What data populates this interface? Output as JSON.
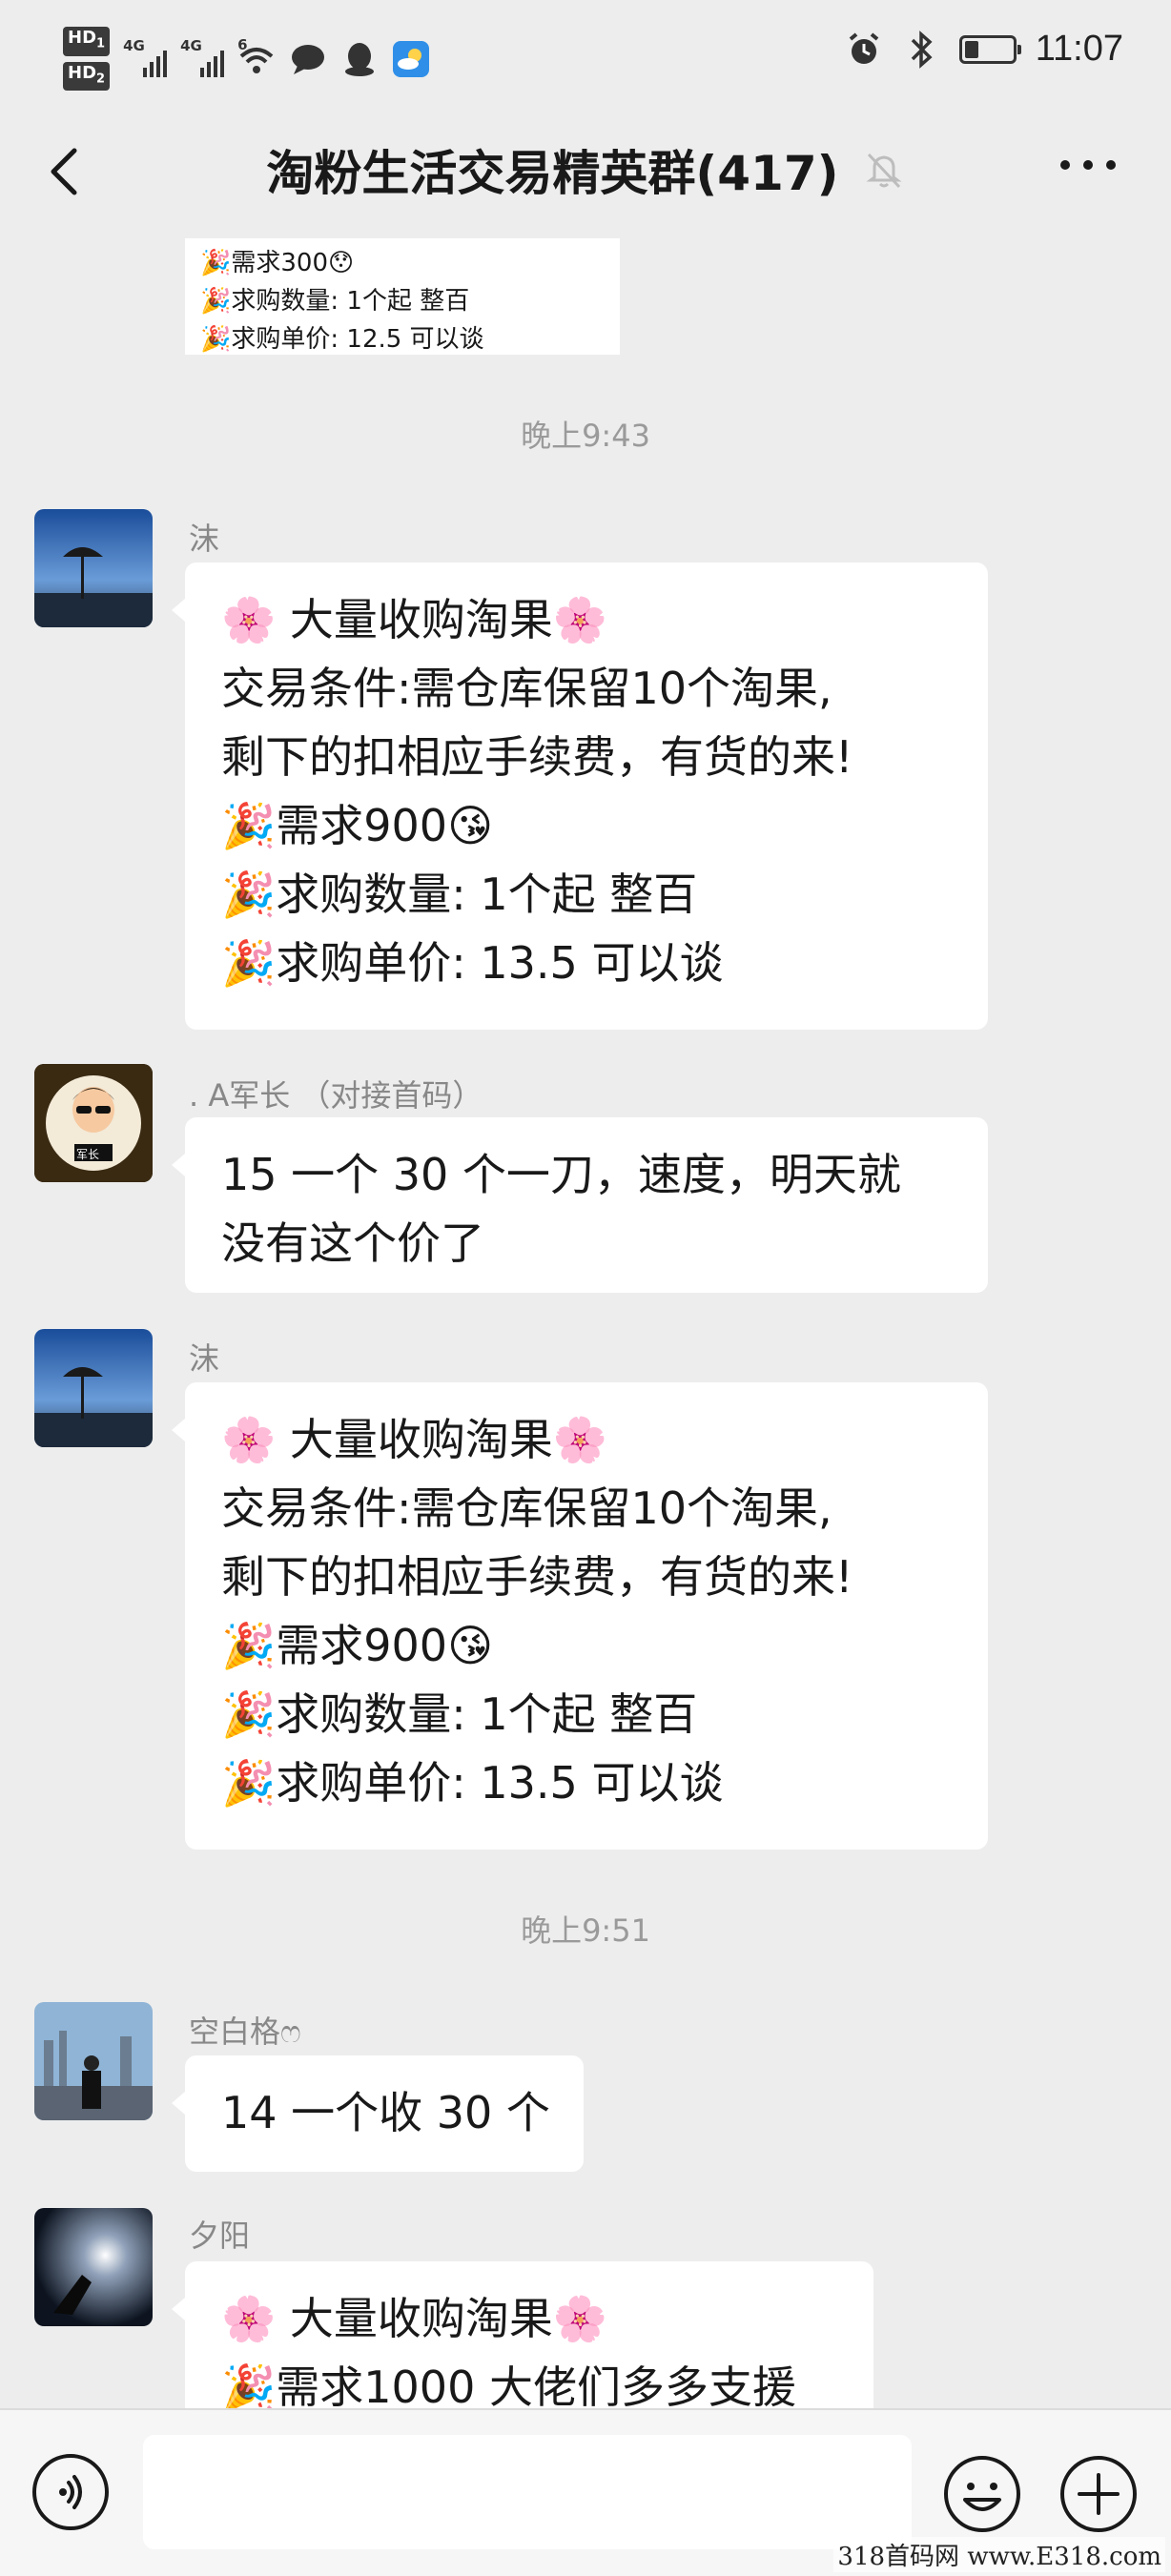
{
  "status_bar": {
    "hd1": "HD",
    "hd1_sub": "1",
    "hd2": "HD",
    "hd2_sub": "2",
    "net1": "4G",
    "net2": "4G",
    "wifi_num": "6",
    "time": "11:07",
    "battery_level": 0.3
  },
  "header": {
    "title": "淘粉生活交易精英群(417)",
    "muted_icon": "bell-off-icon",
    "more_icon": "more-icon"
  },
  "top_image_message": {
    "lines": [
      "🎉需求300😯",
      "🎉求购数量: 1个起   整百",
      "🎉求购单价:    12.5     可以谈"
    ]
  },
  "timestamps": {
    "t1": "晚上9:43",
    "t2": "晚上9:51"
  },
  "messages": [
    {
      "sender": "沫",
      "lines": [
        "🌸 大量收购淘果🌸",
        "交易条件:需仓库保留10个淘果,",
        "剩下的扣相应手续费，有货的来!",
        "🎉需求900😘",
        "🎉求购数量: 1个起   整百",
        "🎉求购单价:   13.5   可以谈"
      ]
    },
    {
      "sender": ". A军长 （对接首码）",
      "lines": [
        "15 一个 30 个一刀，速度，明天就",
        "没有这个价了"
      ]
    },
    {
      "sender": "沫",
      "lines": [
        "🌸 大量收购淘果🌸",
        "交易条件:需仓库保留10个淘果,",
        "剩下的扣相应手续费，有货的来!",
        "🎉需求900😘",
        "🎉求购数量: 1个起   整百",
        "🎉求购单价:   13.5   可以谈"
      ]
    },
    {
      "sender": "空白格ෆ",
      "lines": [
        "14 一个收 30 个"
      ]
    },
    {
      "sender": "夕阳",
      "lines": [
        "🌸 大量收购淘果🌸",
        "🎉需求1000 大佬们多多支援"
      ]
    }
  ],
  "avatar_badge": "军长",
  "input_bar": {
    "placeholder": "",
    "voice_icon": "voice-icon",
    "emoji_icon": "emoji-icon",
    "plus_icon": "plus-icon"
  },
  "watermark": "318首码网  www.E318.com"
}
